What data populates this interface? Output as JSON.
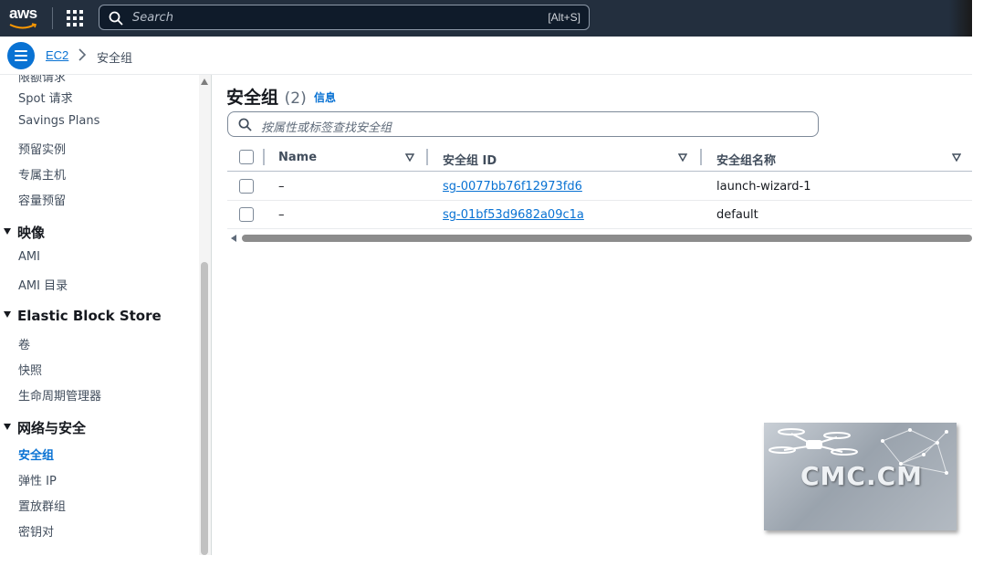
{
  "topbar": {
    "logo_text": "aws",
    "search_placeholder": "Search",
    "search_shortcut": "[Alt+S]"
  },
  "breadcrumb": {
    "root": "EC2",
    "current": "安全组"
  },
  "sidebar": {
    "cut_item": "限额请求",
    "items_top": [
      "Spot 请求",
      "Savings Plans",
      "预留实例",
      "专属主机",
      "容量预留"
    ],
    "sections": [
      {
        "title": "映像",
        "items": [
          "AMI",
          "AMI 目录"
        ]
      },
      {
        "title": "Elastic Block Store",
        "items": [
          "卷",
          "快照",
          "生命周期管理器"
        ]
      },
      {
        "title": "网络与安全",
        "items": [
          "安全组",
          "弹性 IP",
          "置放群组",
          "密钥对"
        ]
      }
    ],
    "active_item": "安全组"
  },
  "main": {
    "title": "安全组",
    "count": "(2)",
    "info_link": "信息",
    "filter_placeholder": "按属性或标签查找安全组",
    "columns": [
      "Name",
      "安全组 ID",
      "安全组名称"
    ],
    "rows": [
      {
        "name": "–",
        "id": "sg-0077bb76f12973fd6",
        "group_name": "launch-wizard-1"
      },
      {
        "name": "–",
        "id": "sg-01bf53d9682a09c1a",
        "group_name": "default"
      }
    ]
  },
  "watermark": {
    "text": "CMC.CM"
  },
  "colors": {
    "nav_bg": "#232f3e",
    "link": "#0972d3",
    "menu_button": "#0972d3"
  }
}
